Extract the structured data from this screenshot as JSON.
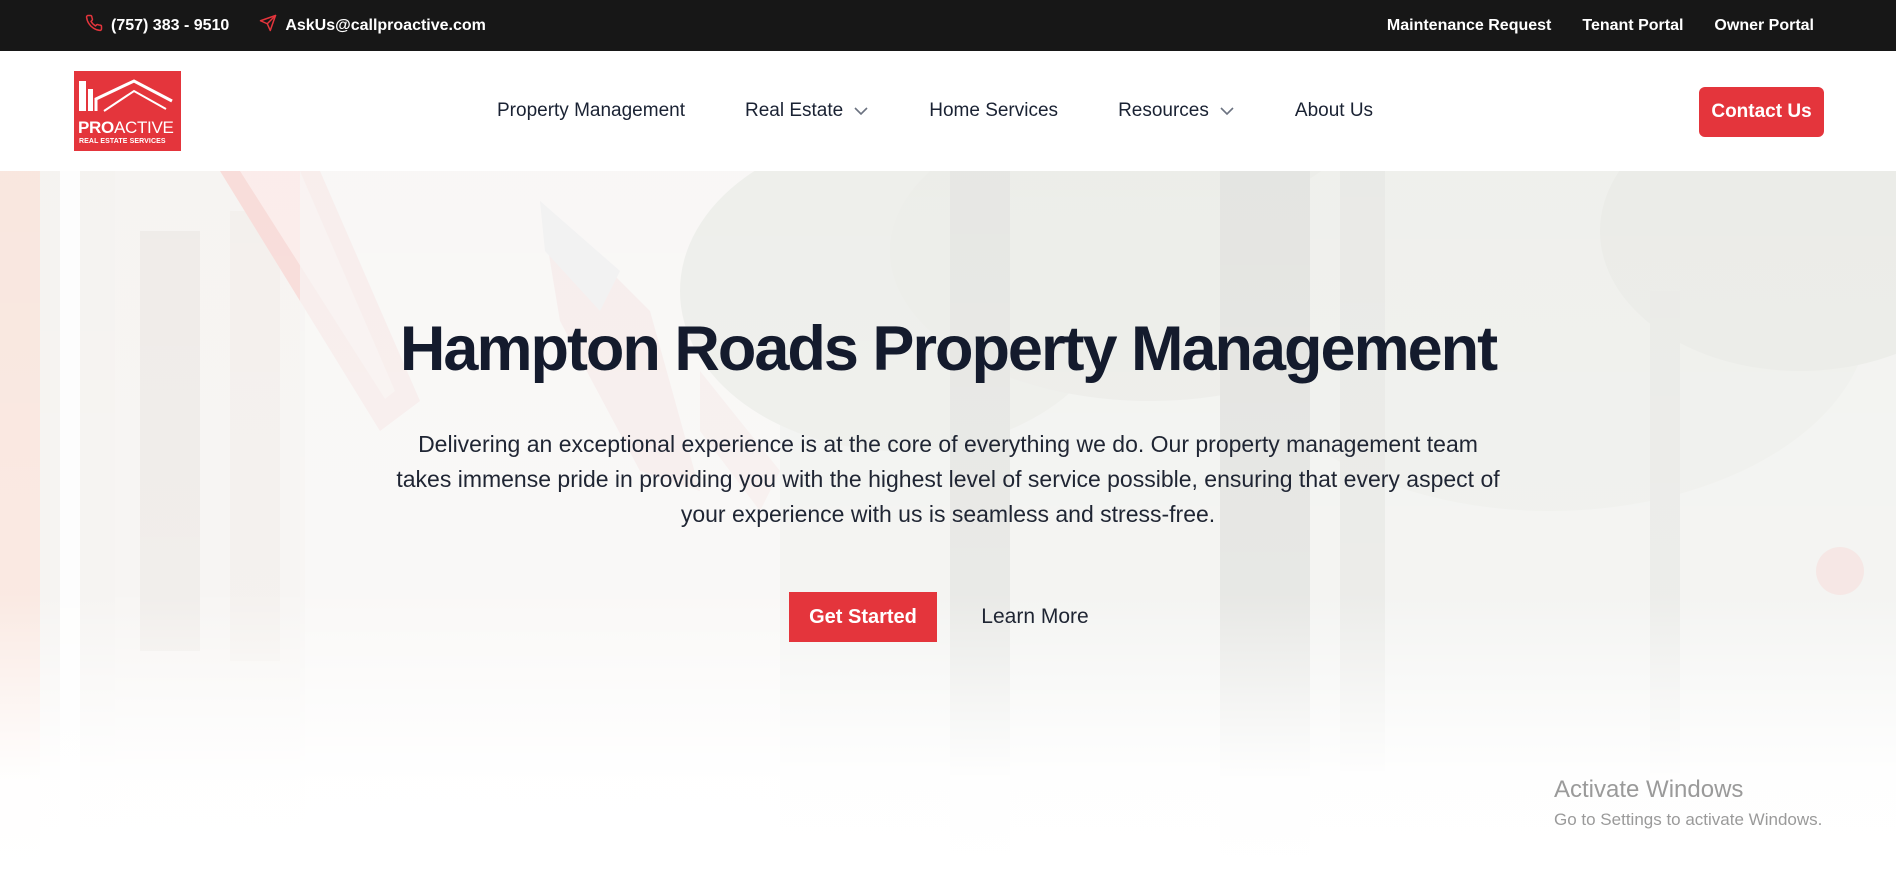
{
  "topbar": {
    "phone": "(757) 383 - 9510",
    "email": "AskUs@callproactive.com",
    "links": [
      "Maintenance Request",
      "Tenant Portal",
      "Owner Portal"
    ],
    "icons": {
      "phone": "phone-icon",
      "email": "paper-plane-icon"
    }
  },
  "header": {
    "logo": {
      "word_bold": "PRO",
      "word_rest": "ACTIVE",
      "tagline": "REAL ESTATE SERVICES"
    },
    "nav": [
      {
        "label": "Property Management",
        "dropdown": false
      },
      {
        "label": "Real Estate",
        "dropdown": true
      },
      {
        "label": "Home Services",
        "dropdown": false
      },
      {
        "label": "Resources",
        "dropdown": true
      },
      {
        "label": "About Us",
        "dropdown": false
      }
    ],
    "contact_button": "Contact Us"
  },
  "hero": {
    "title": "Hampton Roads Property Management",
    "subtitle": "Delivering an exceptional experience is at the core of everything we do. Our property management team takes immense pride in providing you with the highest level of service possible, ensuring that every aspect of your experience with us is seamless and stress-free.",
    "primary_button": "Get Started",
    "secondary_button": "Learn More"
  },
  "watermark": {
    "title": "Activate Windows",
    "subtitle": "Go to Settings to activate Windows."
  },
  "colors": {
    "accent": "#e4353c",
    "topbar_bg": "#171717",
    "heading": "#141b2d"
  }
}
